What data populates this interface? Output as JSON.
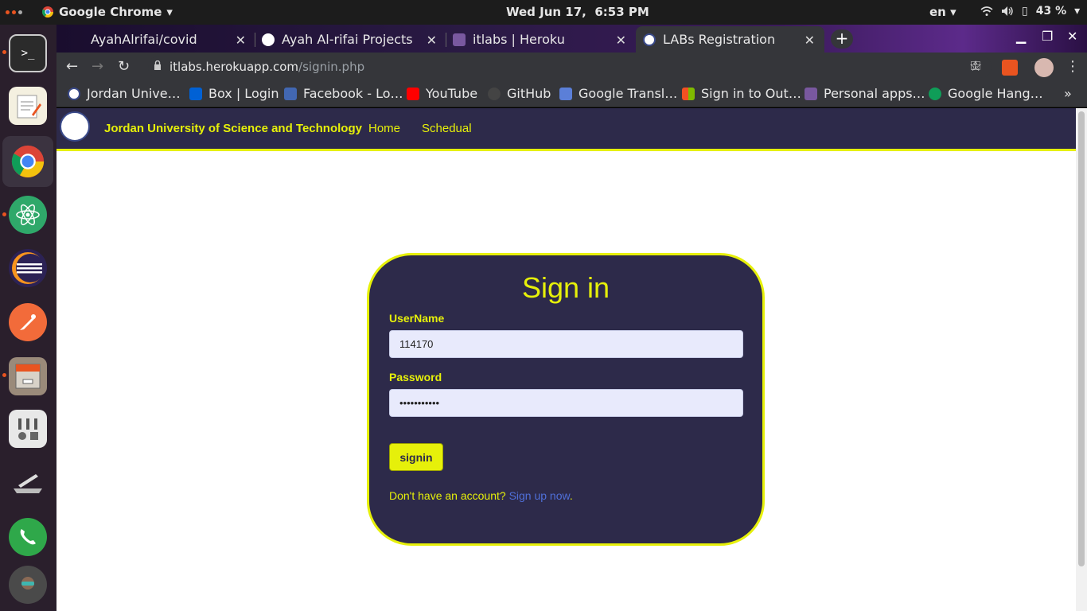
{
  "system": {
    "app_name": "Google Chrome",
    "clock": "Wed Jun 17,  6:53 PM",
    "language": "en",
    "battery": "43 %"
  },
  "browser": {
    "tabs": [
      {
        "title": "AyahAlrifai/covid",
        "active": false
      },
      {
        "title": "Ayah Al-rifai Projects",
        "active": false
      },
      {
        "title": "itlabs | Heroku",
        "active": false
      },
      {
        "title": "LABs Registration",
        "active": true
      }
    ],
    "url_host": "itlabs.herokuapp.com",
    "url_path": "/signin.php",
    "bookmarks": [
      "Jordan Unive…",
      "Box | Login",
      "Facebook - Lo…",
      "YouTube",
      "GitHub",
      "Google Transl…",
      "Sign in to Out…",
      "Personal apps…",
      "Google Hang…"
    ]
  },
  "site": {
    "brand": "Jordan University of Science and Technology",
    "nav": [
      "Home",
      "Schedual"
    ]
  },
  "signin": {
    "title": "Sign in",
    "username_label": "UserName",
    "username_value": "114170",
    "password_label": "Password",
    "password_value": "•••••••••••",
    "submit_label": "signin",
    "footer_text": "Don't have an account?",
    "signup_link": "Sign up now",
    "footer_end": "."
  },
  "colors": {
    "accent": "#e6f00a",
    "card_bg": "#2d2a4a",
    "link": "#4f6fd8"
  }
}
